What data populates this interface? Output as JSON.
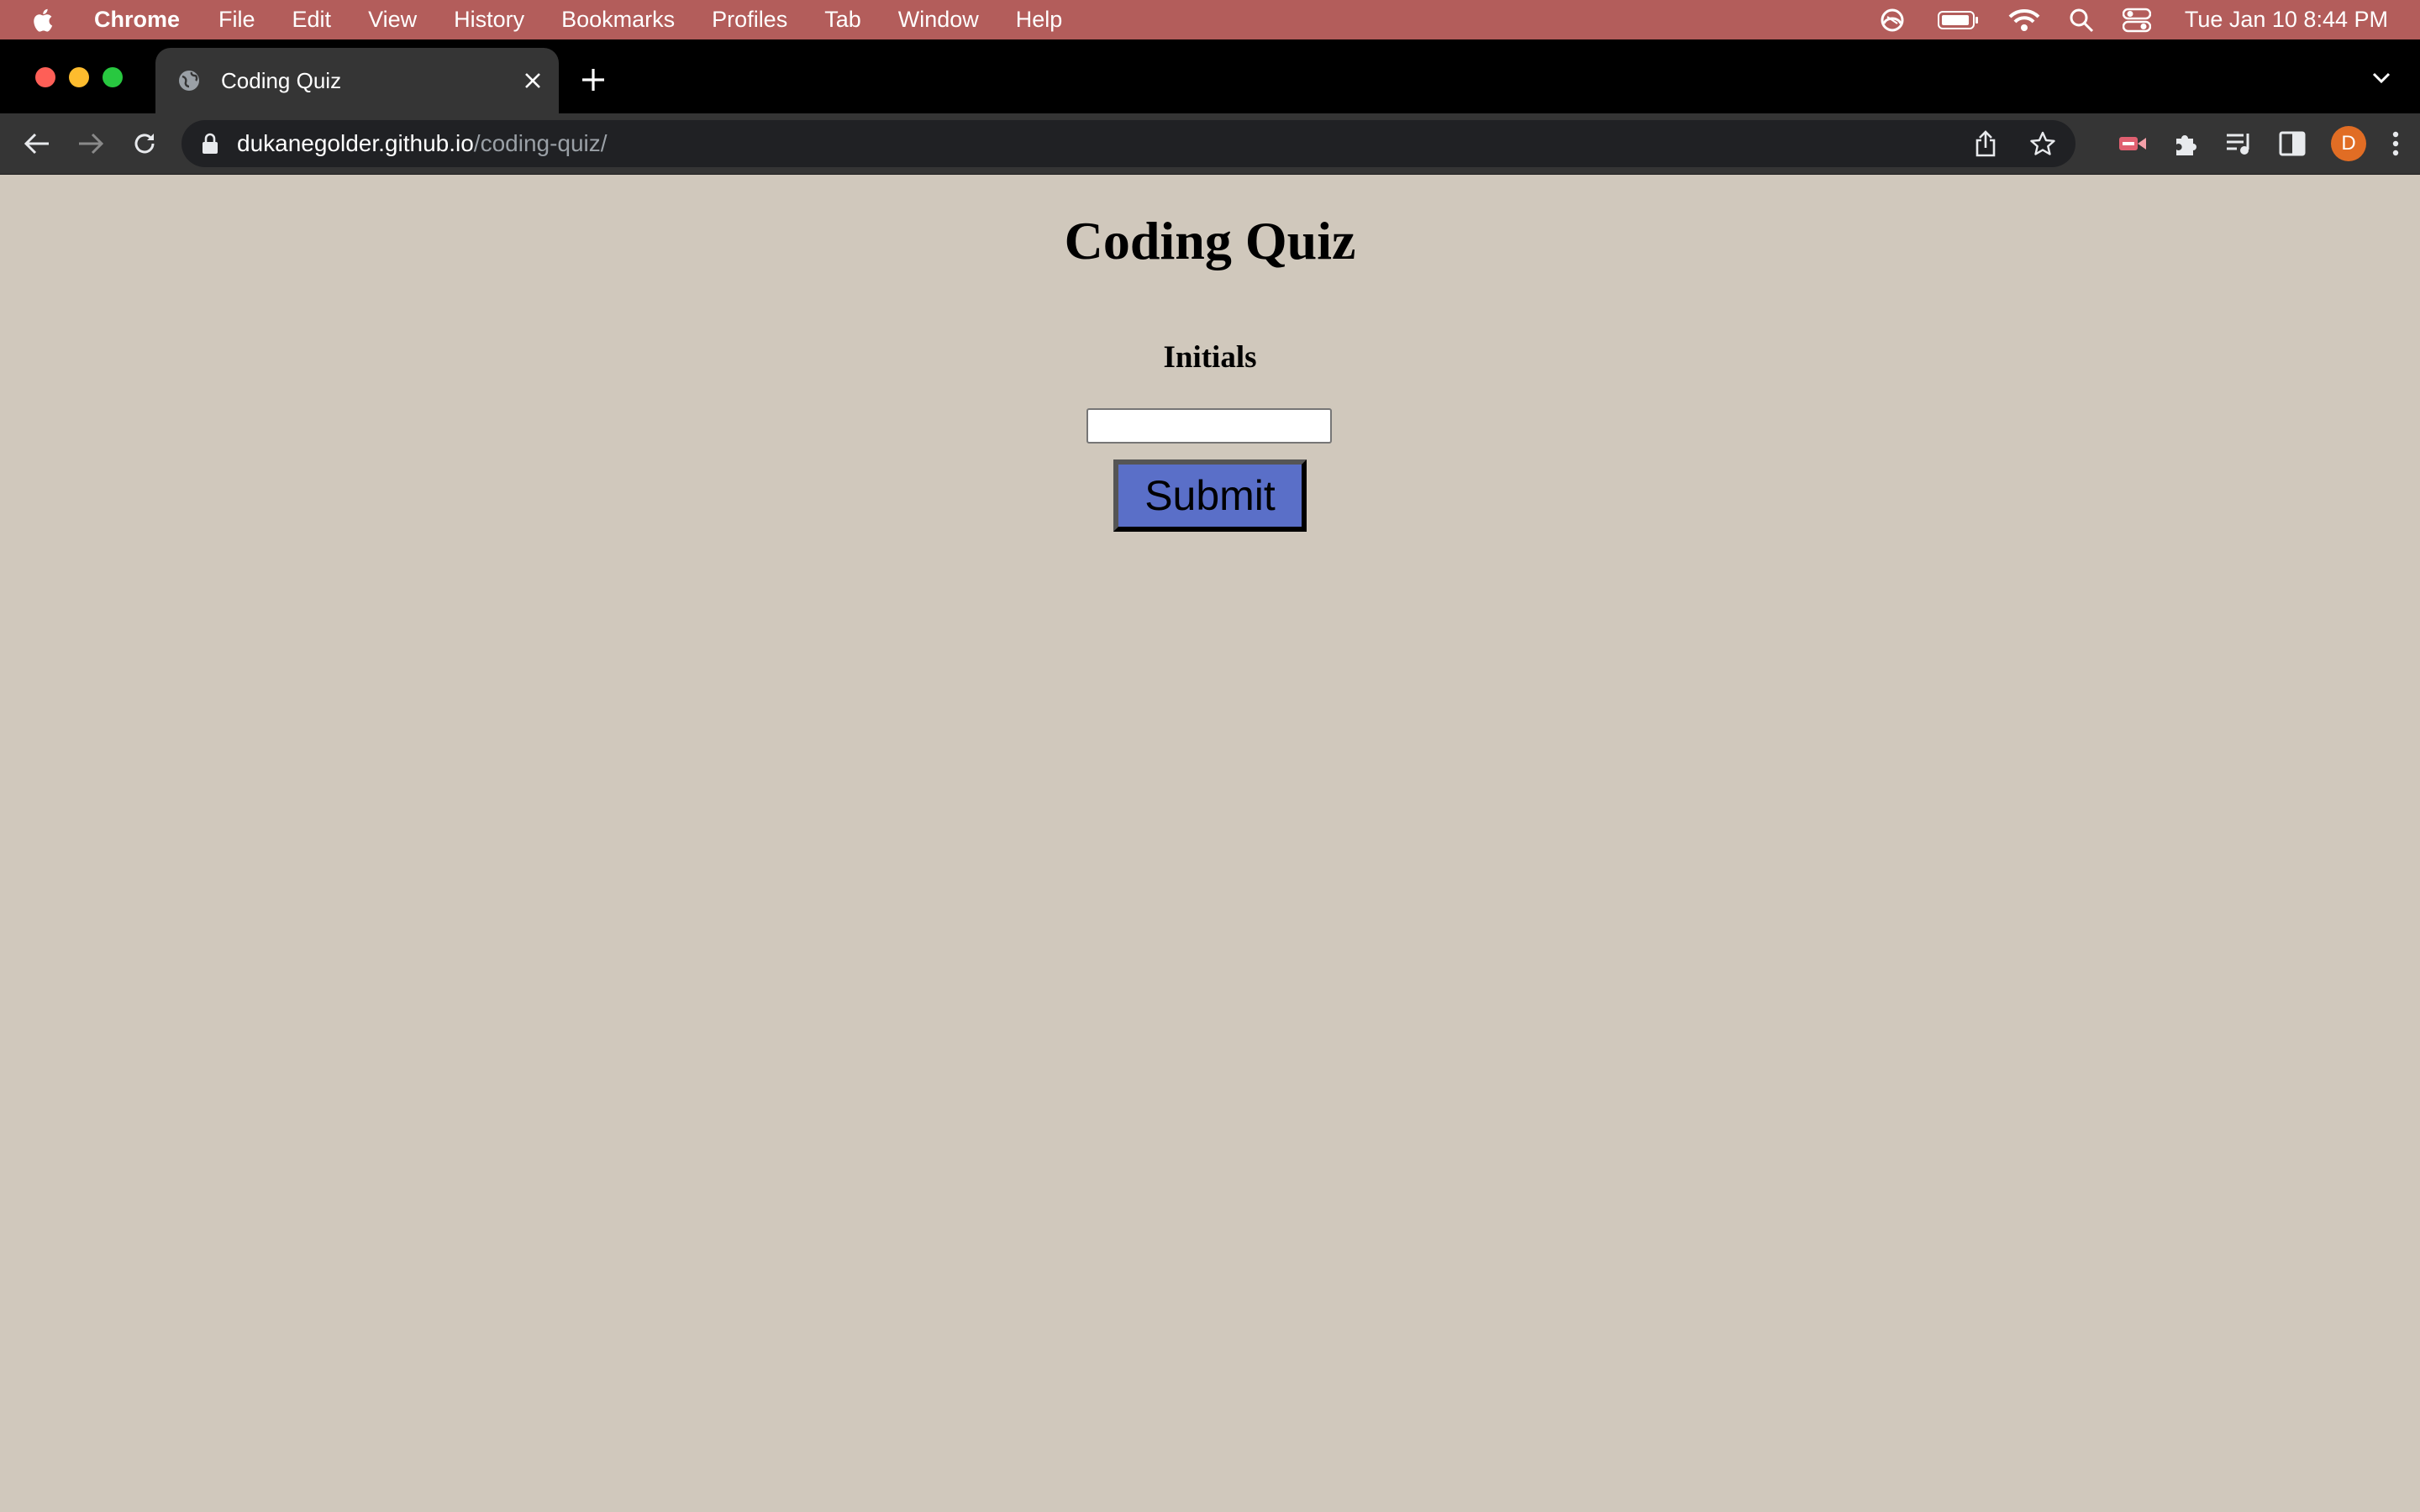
{
  "menubar": {
    "app_name": "Chrome",
    "items": [
      "File",
      "Edit",
      "View",
      "History",
      "Bookmarks",
      "Profiles",
      "Tab",
      "Window",
      "Help"
    ],
    "clock": "Tue Jan 10  8:44 PM"
  },
  "tab": {
    "title": "Coding Quiz"
  },
  "omnibox": {
    "host": "dukanegolder.github.io",
    "path": "/coding-quiz/"
  },
  "profile": {
    "initial": "D"
  },
  "page": {
    "heading": "Coding Quiz",
    "initials_label": "Initials",
    "initials_value": "",
    "submit_label": "Submit"
  },
  "colors": {
    "menubar_bg": "#b35d5b",
    "page_bg": "#d0c8bc",
    "submit_bg": "#5a6fc8",
    "avatar_bg": "#e16d24"
  }
}
